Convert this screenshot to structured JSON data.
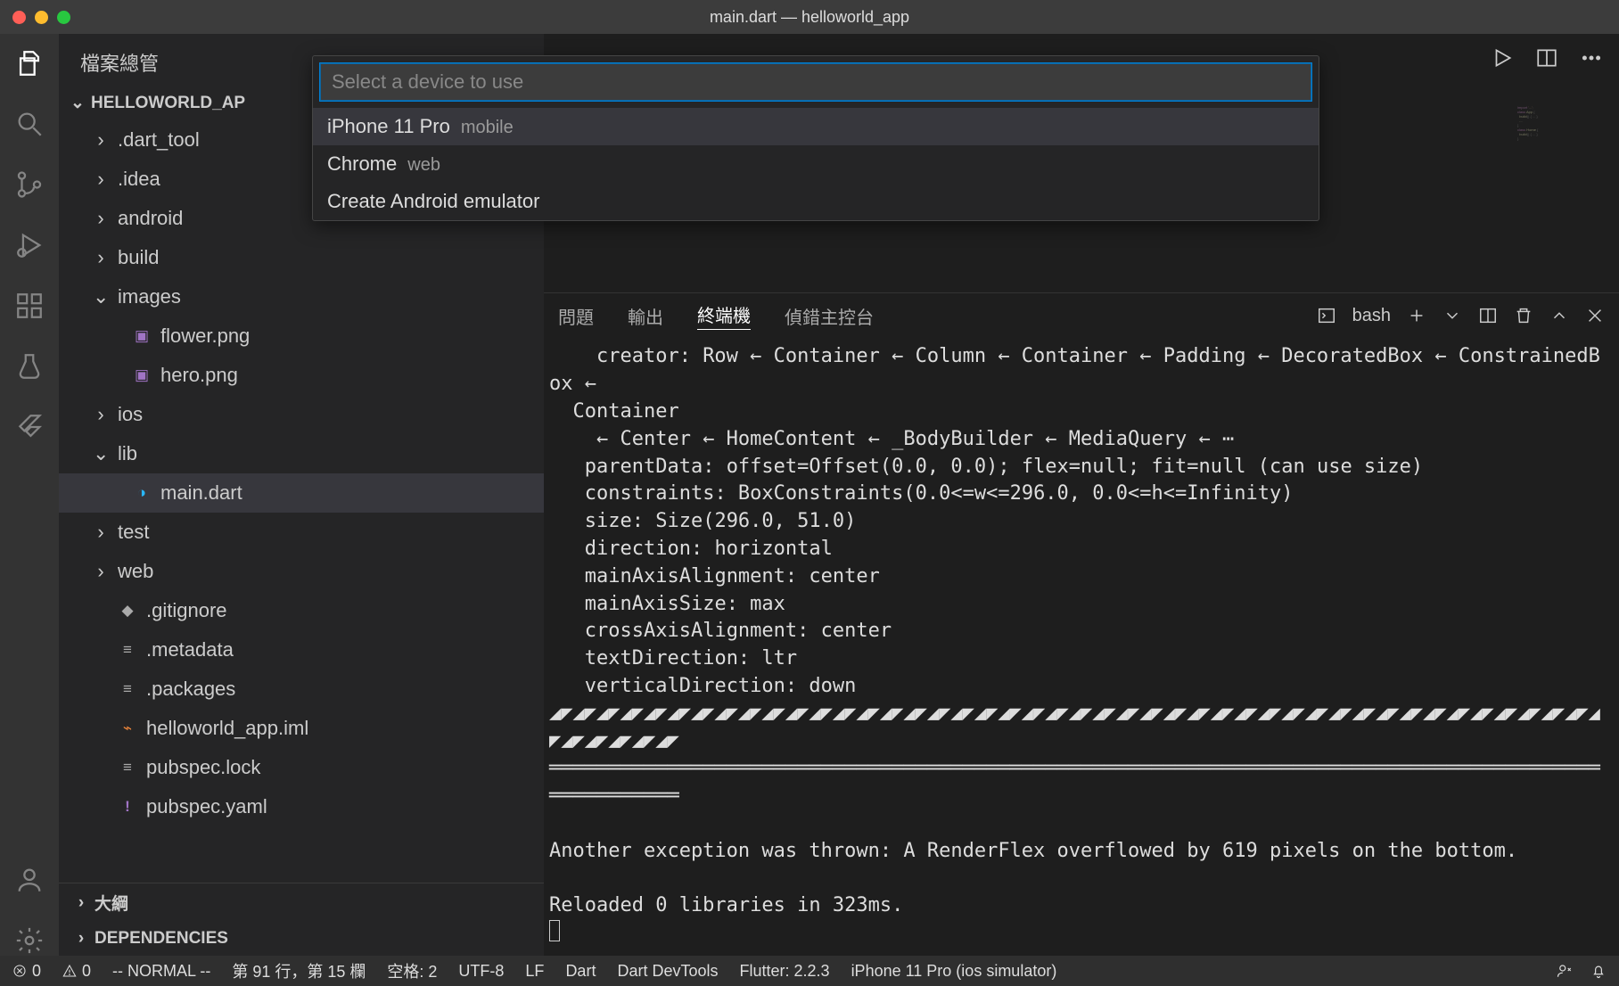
{
  "window": {
    "title": "main.dart — helloworld_app"
  },
  "sidebar": {
    "title": "檔案總管",
    "project": "HELLOWORLD_AP",
    "tree": [
      {
        "label": ".dart_tool",
        "kind": "folder",
        "expanded": false,
        "depth": 1
      },
      {
        "label": ".idea",
        "kind": "folder",
        "expanded": false,
        "depth": 1
      },
      {
        "label": "android",
        "kind": "folder",
        "expanded": false,
        "depth": 1
      },
      {
        "label": "build",
        "kind": "folder",
        "expanded": false,
        "depth": 1
      },
      {
        "label": "images",
        "kind": "folder",
        "expanded": true,
        "depth": 1
      },
      {
        "label": "flower.png",
        "kind": "image",
        "depth": 2
      },
      {
        "label": "hero.png",
        "kind": "image",
        "depth": 2
      },
      {
        "label": "ios",
        "kind": "folder",
        "expanded": false,
        "depth": 1
      },
      {
        "label": "lib",
        "kind": "folder",
        "expanded": true,
        "depth": 1
      },
      {
        "label": "main.dart",
        "kind": "dart",
        "depth": 2,
        "selected": true
      },
      {
        "label": "test",
        "kind": "folder",
        "expanded": false,
        "depth": 1
      },
      {
        "label": "web",
        "kind": "folder",
        "expanded": false,
        "depth": 1
      },
      {
        "label": ".gitignore",
        "kind": "git",
        "depth": 1
      },
      {
        "label": ".metadata",
        "kind": "lines",
        "depth": 1
      },
      {
        "label": ".packages",
        "kind": "lines",
        "depth": 1
      },
      {
        "label": "helloworld_app.iml",
        "kind": "rss",
        "depth": 1
      },
      {
        "label": "pubspec.lock",
        "kind": "lines",
        "depth": 1
      },
      {
        "label": "pubspec.yaml",
        "kind": "excl",
        "depth": 1
      }
    ],
    "outline": "大綱",
    "dependencies": "DEPENDENCIES"
  },
  "picker": {
    "placeholder": "Select a device to use",
    "items": [
      {
        "label": "iPhone 11 Pro",
        "hint": "mobile",
        "selected": true
      },
      {
        "label": "Chrome",
        "hint": "web"
      },
      {
        "label": "Create Android emulator",
        "hint": ""
      }
    ]
  },
  "panel": {
    "tabs": {
      "problems": "問題",
      "output": "輸出",
      "terminal": "終端機",
      "debug": "偵錯主控台"
    },
    "shell": "bash",
    "terminal_text": "    creator: Row ← Container ← Column ← Container ← Padding ← DecoratedBox ← ConstrainedBox ←\n  Container\n    ← Center ← HomeContent ← _BodyBuilder ← MediaQuery ← ⋯\n   parentData: offset=Offset(0.0, 0.0); flex=null; fit=null (can use size)\n   constraints: BoxConstraints(0.0<=w<=296.0, 0.0<=h<=Infinity)\n   size: Size(296.0, 51.0)\n   direction: horizontal\n   mainAxisAlignment: center\n   mainAxisSize: max\n   crossAxisAlignment: center\n   textDirection: ltr\n   verticalDirection: down\n◢◤◢◤◢◤◢◤◢◤◢◤◢◤◢◤◢◤◢◤◢◤◢◤◢◤◢◤◢◤◢◤◢◤◢◤◢◤◢◤◢◤◢◤◢◤◢◤◢◤◢◤◢◤◢◤◢◤◢◤◢◤◢◤◢◤◢◤◢◤◢◤◢◤◢◤◢◤◢◤◢◤◢◤◢◤◢◤◢◤◢◤◢◤◢◤◢◤◢◤\n════════════════════════════════════════════════════════════════════════════════════════════════════\n\nAnother exception was thrown: A RenderFlex overflowed by 619 pixels on the bottom.\n\nReloaded 0 libraries in 323ms.\n"
  },
  "status": {
    "errors": "0",
    "warnings": "0",
    "mode": "-- NORMAL --",
    "position": "第 91 行，第 15 欄",
    "spaces": "空格: 2",
    "encoding": "UTF-8",
    "eol": "LF",
    "language": "Dart",
    "devtools": "Dart DevTools",
    "flutter": "Flutter: 2.2.3",
    "device": "iPhone 11 Pro (ios simulator)"
  }
}
